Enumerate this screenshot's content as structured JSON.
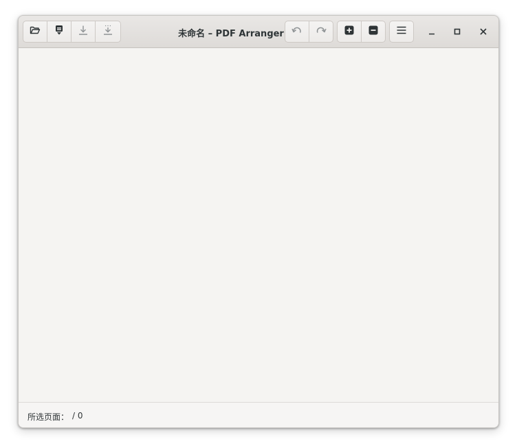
{
  "window": {
    "title": "未命名 – PDF Arranger"
  },
  "toolbar_left": {
    "open": {
      "icon": "folder-open-icon"
    },
    "import": {
      "icon": "import-page-icon"
    },
    "save": {
      "icon": "download-icon"
    },
    "save_as": {
      "icon": "download-dotted-icon"
    }
  },
  "toolbar_right": {
    "undo": {
      "icon": "undo-icon"
    },
    "redo": {
      "icon": "redo-icon"
    },
    "zoom_in": {
      "icon": "zoom-in-icon"
    },
    "zoom_out": {
      "icon": "zoom-out-icon"
    },
    "menu": {
      "icon": "hamburger-menu-icon"
    }
  },
  "window_controls": {
    "minimize": {
      "icon": "minimize-icon"
    },
    "maximize": {
      "icon": "maximize-icon"
    },
    "close": {
      "icon": "close-icon"
    }
  },
  "statusbar": {
    "label": "所选页面：",
    "value": "/ 0"
  },
  "colors": {
    "window_bg": "#f6f5f4",
    "headerbar_bg": "#e4e2df",
    "icon": "#2e3436",
    "icon_disabled": "#8f9395"
  }
}
